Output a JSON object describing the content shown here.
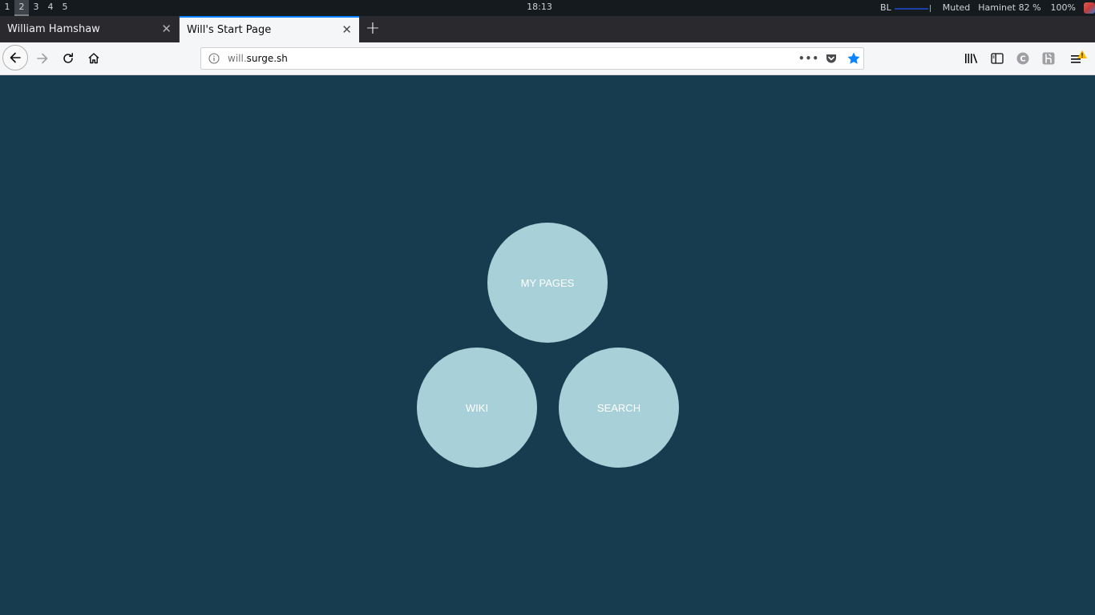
{
  "system_bar": {
    "workspaces": [
      "1",
      "2",
      "3",
      "4",
      "5"
    ],
    "active_workspace": "2",
    "clock": "18:13",
    "backlight_label": "BL",
    "audio": "Muted",
    "network": "Haminet 82 %",
    "volume": "100%"
  },
  "tabs": [
    {
      "title": "William Hamshaw",
      "close": "✕",
      "active": false
    },
    {
      "title": "Will's Start Page",
      "close": "✕",
      "active": true
    }
  ],
  "new_tab_label": "+",
  "urlbar": {
    "domain_prefix": "will.",
    "domain_main": "surge.sh",
    "more_label": "•••"
  },
  "colors": {
    "page_background": "#183c4f",
    "circle": "#a8d0d8",
    "accent": "#0a84ff"
  },
  "links": {
    "my_pages": "MY PAGES",
    "wiki": "WIKI",
    "search": "SEARCH"
  }
}
